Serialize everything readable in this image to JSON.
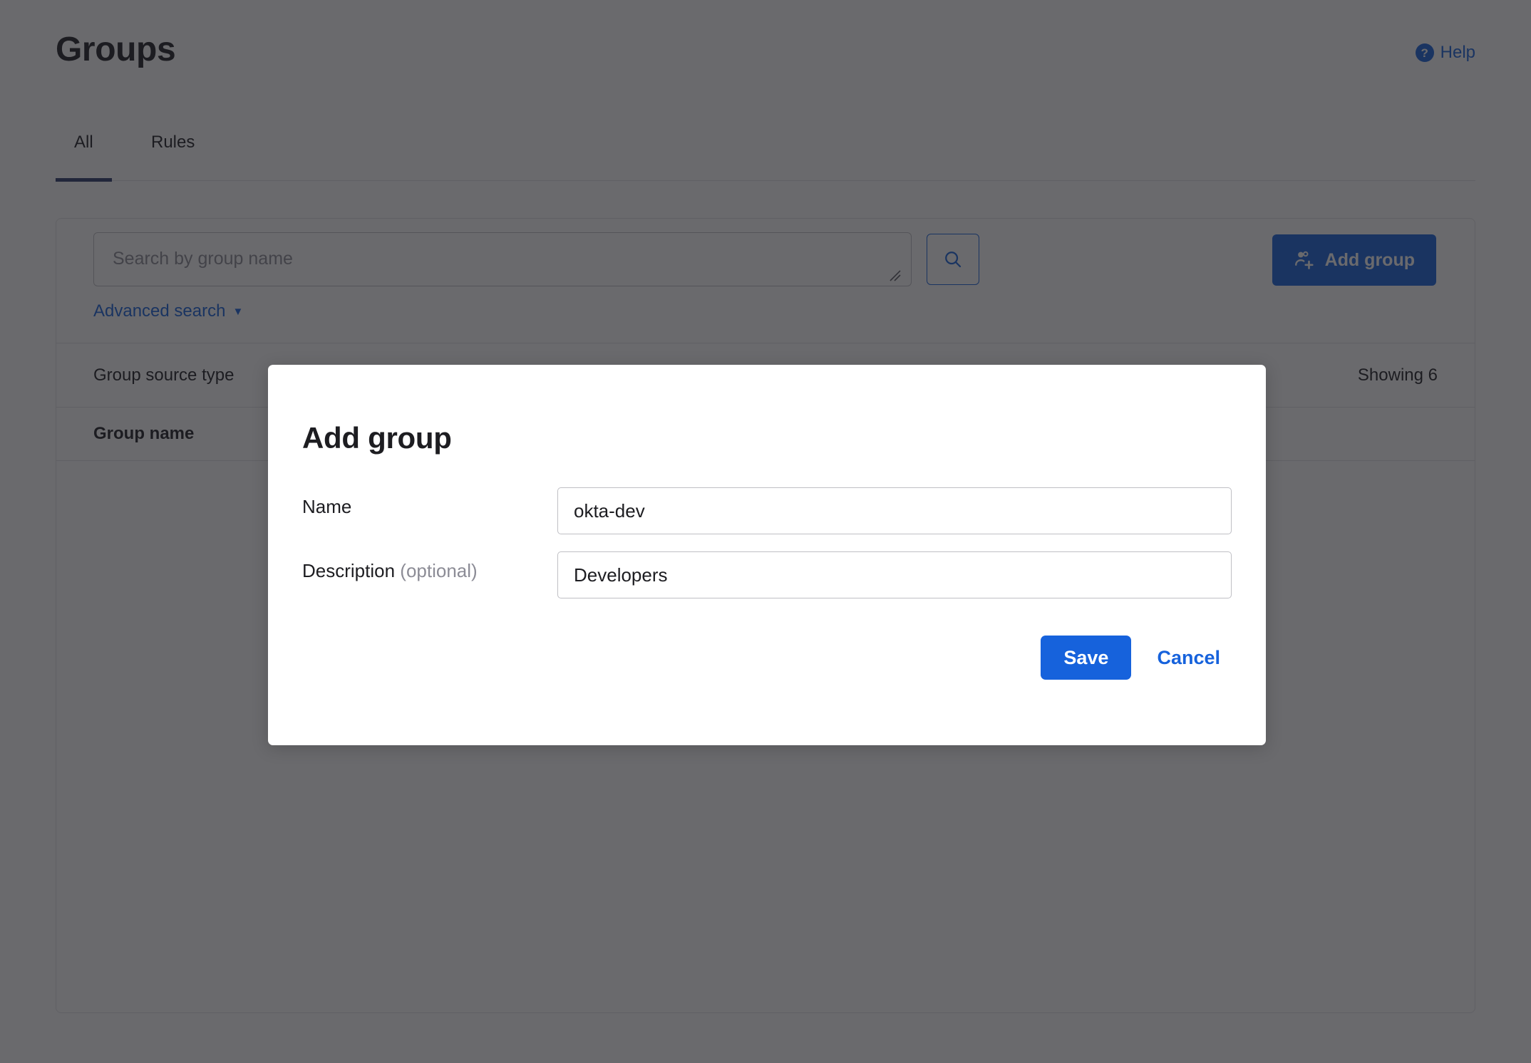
{
  "header": {
    "title": "Groups",
    "help_label": "Help",
    "help_icon": "question-circle-icon"
  },
  "tabs": [
    {
      "label": "All",
      "active": true
    },
    {
      "label": "Rules",
      "active": false
    }
  ],
  "toolbar": {
    "search_placeholder": "Search by group name",
    "search_value": "",
    "search_button_icon": "search-icon",
    "advanced_search_label": "Advanced search",
    "advanced_search_caret": "▼",
    "add_group_label": "Add group",
    "add_group_icon": "people-add-icon"
  },
  "filters": {
    "group_source_type_label": "Group source type",
    "showing_label": "Showing 6"
  },
  "table": {
    "columns": [
      "Group name"
    ],
    "rows": []
  },
  "modal": {
    "title": "Add group",
    "name": {
      "label": "Name",
      "value": "okta-dev",
      "placeholder": ""
    },
    "description": {
      "label": "Description",
      "optional_suffix": "(optional)",
      "value": "Developers",
      "placeholder": ""
    },
    "save_label": "Save",
    "cancel_label": "Cancel"
  },
  "colors": {
    "accent_blue": "#1662dc",
    "tab_underline": "#293a6b",
    "text_primary": "#1d1d21",
    "text_muted": "#8c8c96",
    "border": "#e1e1e3",
    "scrim": "rgba(29,29,33,0.66)"
  }
}
